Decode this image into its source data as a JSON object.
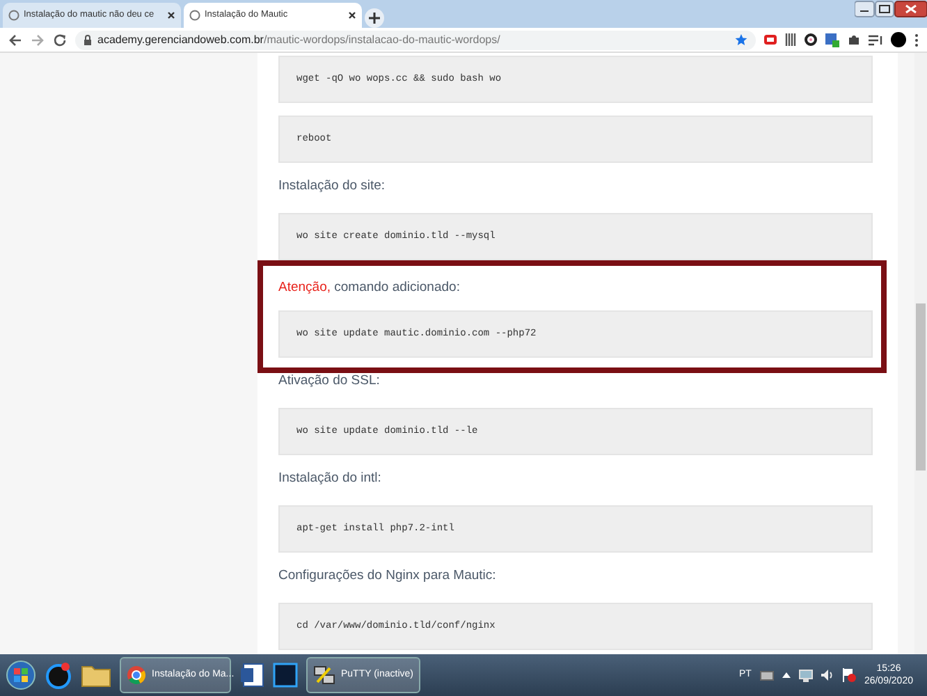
{
  "browser": {
    "tabs": [
      {
        "title": "Instalação do mautic não deu ce",
        "selected": false
      },
      {
        "title": "Instalação do Mautic",
        "selected": true
      }
    ],
    "url": {
      "host": "academy.gerenciandoweb.com.br",
      "path": "/mautic-wordops/instalacao-do-mautic-wordops/"
    }
  },
  "article": [
    {
      "kind": "code",
      "text": "wget -qO wo wops.cc && sudo bash wo"
    },
    {
      "kind": "code",
      "text": "reboot"
    },
    {
      "kind": "text",
      "text": "Instalação do site:"
    },
    {
      "kind": "code",
      "text": "wo site create dominio.tld --mysql"
    },
    {
      "kind": "callout",
      "alert": "Atenção,",
      "text": "comando adicionado:",
      "code": "wo site update mautic.dominio.com --php72"
    },
    {
      "kind": "text",
      "text": "Ativação do SSL:"
    },
    {
      "kind": "code",
      "text": "wo site update dominio.tld --le"
    },
    {
      "kind": "text",
      "text": "Instalação do intl:"
    },
    {
      "kind": "code",
      "text": "apt-get install php7.2-intl"
    },
    {
      "kind": "text",
      "text": "Configurações do Nginx para Mautic:"
    },
    {
      "kind": "code",
      "text": "cd /var/www/dominio.tld/conf/nginx"
    }
  ],
  "taskbar": {
    "buttons": [
      {
        "kind": "browser",
        "label": "Instalação do Ma..."
      },
      {
        "kind": "terminal",
        "label": "PuTTY (inactive)"
      }
    ],
    "language": "PT",
    "time": "15:26",
    "date": "26/09/2020"
  }
}
